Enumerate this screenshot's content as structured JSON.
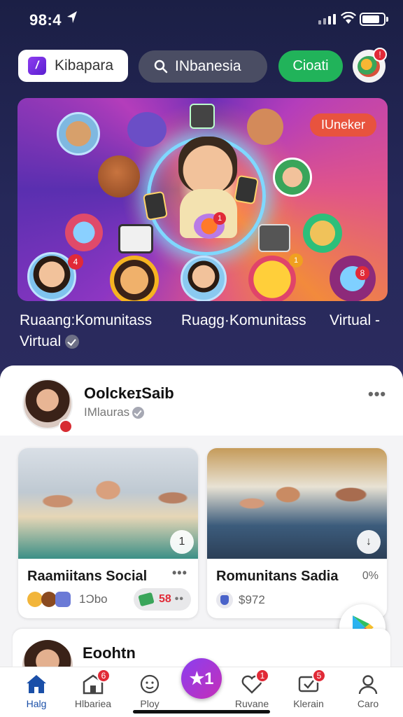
{
  "status_bar": {
    "time": "98:4"
  },
  "top_nav": {
    "brand_label": "Kibapara",
    "search_label": "INbanesia",
    "green_button_label": "Cioati",
    "green_button_icon": "refresh-icon",
    "avatar_badge": "!"
  },
  "hero": {
    "badge": "IUneker",
    "badge_color": "#e8533e",
    "notification_counts": [
      "4",
      "1",
      "8",
      "1"
    ],
    "captions": [
      "Ruaang:Komunitass",
      "Virtual",
      "Ruagg·Komunitass",
      "Virtual -"
    ]
  },
  "profile": {
    "name": "OolckeɪSaib",
    "subtitle": "IMlauras",
    "more_label": "•••"
  },
  "cards": [
    {
      "title": "Raamiitans Social",
      "meta": "1Ɔbo",
      "chip": "1",
      "pill_value": "58",
      "pill_dots": "••",
      "more_label": "•••"
    },
    {
      "title": "Romunitans Sadia",
      "meta": "$972",
      "chip": "↓",
      "percent": "0%",
      "more_label": ""
    }
  ],
  "post2": {
    "name": "Eoohtn"
  },
  "center_fab_label": "★1",
  "bottom_nav": [
    {
      "label": "Halg",
      "icon": "home-icon",
      "badge": ""
    },
    {
      "label": "Hlbariea",
      "icon": "store-icon",
      "badge": "6"
    },
    {
      "label": "Ploy",
      "icon": "smiley-icon",
      "badge": ""
    },
    {
      "label": "Ruvane",
      "icon": "heart-icon",
      "badge": "1"
    },
    {
      "label": "Klerain",
      "icon": "checkbox-icon",
      "badge": "5"
    },
    {
      "label": "Caro",
      "icon": "person-icon",
      "badge": ""
    }
  ],
  "colors": {
    "accent_green": "#21b35a",
    "badge_red": "#e12a37",
    "nav_active": "#1a4fa8",
    "fab_gradient_start": "#8a3ff0"
  }
}
